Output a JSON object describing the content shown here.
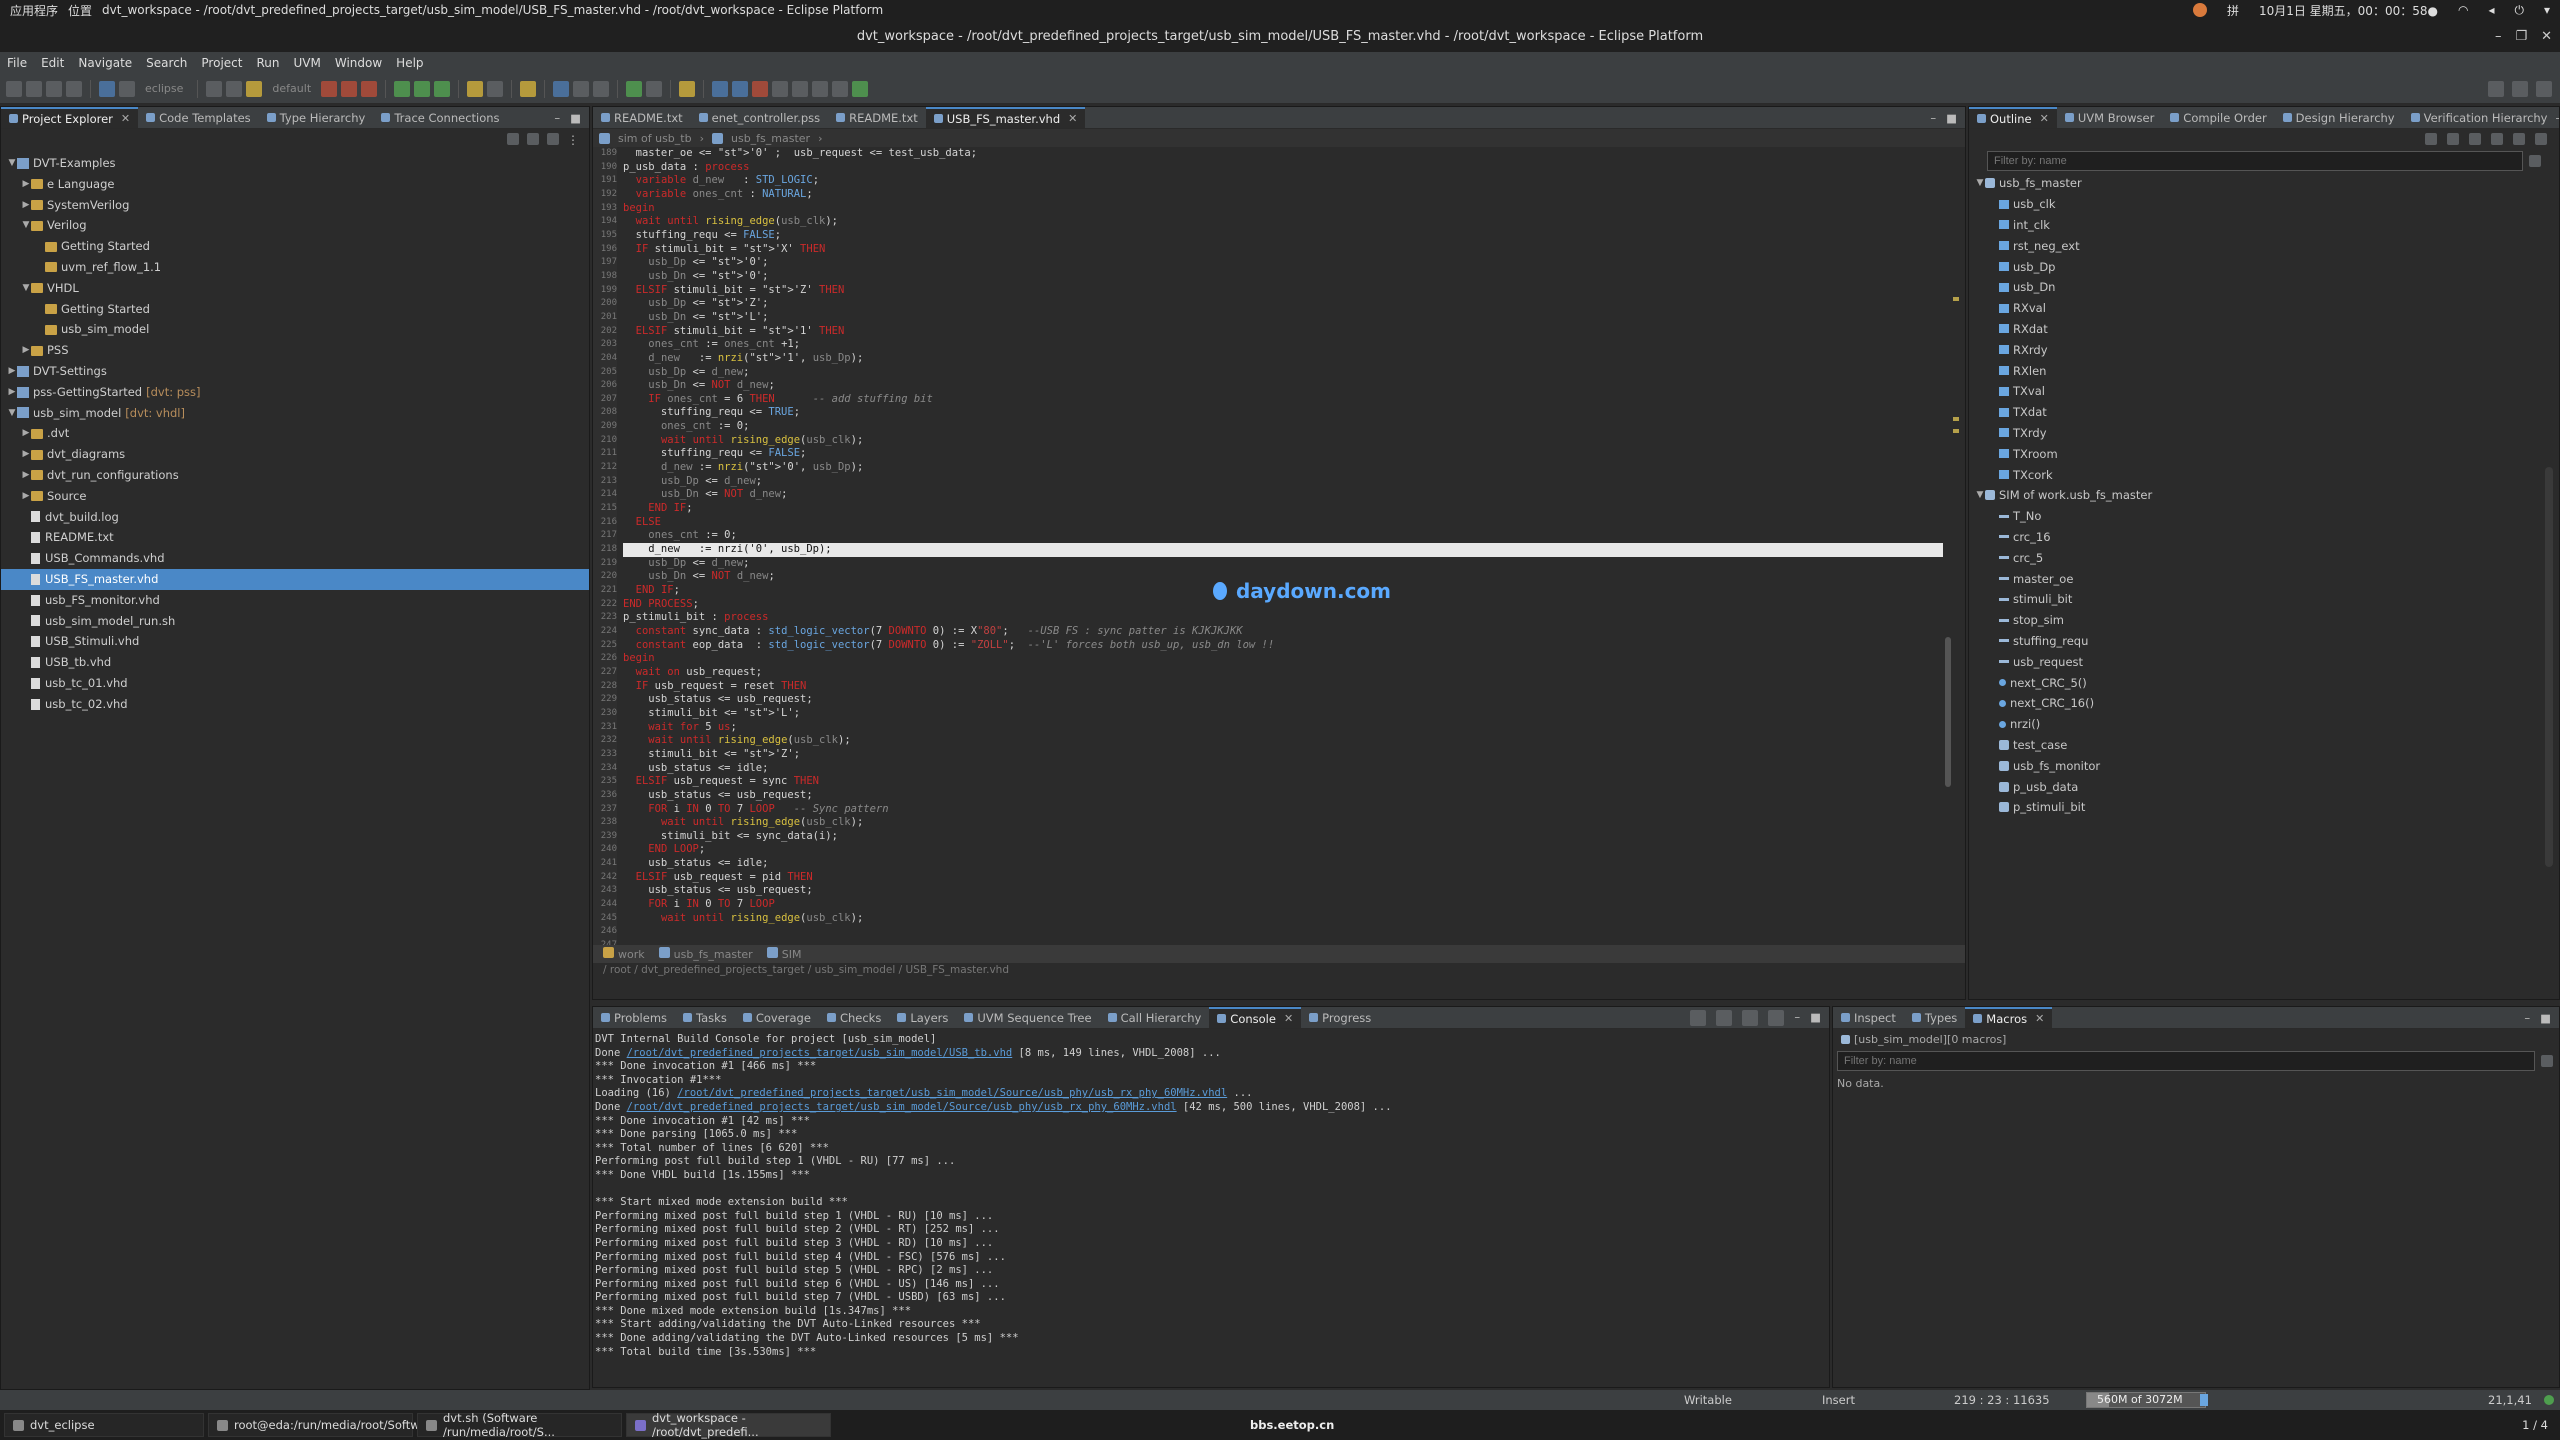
{
  "sys": {
    "apps": "应用程序",
    "places": "位置",
    "window": "dvt_workspace - /root/dvt_predefined_projects_target/usb_sim_model/USB_FS_master.vhd - /root/dvt_workspace - Eclipse Platform",
    "ime": "拼",
    "clock": "10月1日 星期五，00：00：58●"
  },
  "title": "dvt_workspace - /root/dvt_predefined_projects_target/usb_sim_model/USB_FS_master.vhd - /root/dvt_workspace - Eclipse Platform",
  "menu": [
    "File",
    "Edit",
    "Navigate",
    "Search",
    "Project",
    "Run",
    "UVM",
    "Window",
    "Help"
  ],
  "toolbar": {
    "eclipse_label": "eclipse",
    "default_label": "default"
  },
  "left_tabs": [
    {
      "label": "Project Explorer",
      "active": true
    },
    {
      "label": "Code Templates"
    },
    {
      "label": "Type Hierarchy"
    },
    {
      "label": "Trace Connections"
    }
  ],
  "tree": [
    {
      "d": 0,
      "t": "v",
      "k": "proj",
      "l": "DVT-Examples"
    },
    {
      "d": 1,
      "t": ">",
      "k": "fold",
      "l": "e Language"
    },
    {
      "d": 1,
      "t": ">",
      "k": "fold",
      "l": "SystemVerilog"
    },
    {
      "d": 1,
      "t": "v",
      "k": "fold",
      "l": "Verilog"
    },
    {
      "d": 2,
      "t": "",
      "k": "fold",
      "l": "Getting Started"
    },
    {
      "d": 2,
      "t": "",
      "k": "fold",
      "l": "uvm_ref_flow_1.1"
    },
    {
      "d": 1,
      "t": "v",
      "k": "fold",
      "l": "VHDL"
    },
    {
      "d": 2,
      "t": "",
      "k": "fold",
      "l": "Getting Started"
    },
    {
      "d": 2,
      "t": "",
      "k": "fold",
      "l": "usb_sim_model"
    },
    {
      "d": 1,
      "t": ">",
      "k": "fold",
      "l": "PSS"
    },
    {
      "d": 0,
      "t": ">",
      "k": "proj",
      "l": "DVT-Settings"
    },
    {
      "d": 0,
      "t": ">",
      "k": "proj",
      "l": "pss-GettingStarted",
      "x": "[dvt: pss]"
    },
    {
      "d": 0,
      "t": "v",
      "k": "proj",
      "l": "usb_sim_model",
      "x": "[dvt: vhdl]"
    },
    {
      "d": 1,
      "t": ">",
      "k": "fold",
      "l": ".dvt"
    },
    {
      "d": 1,
      "t": ">",
      "k": "fold",
      "l": "dvt_diagrams"
    },
    {
      "d": 1,
      "t": ">",
      "k": "fold",
      "l": "dvt_run_configurations"
    },
    {
      "d": 1,
      "t": ">",
      "k": "fold",
      "l": "Source"
    },
    {
      "d": 1,
      "t": "",
      "k": "file",
      "l": "dvt_build.log"
    },
    {
      "d": 1,
      "t": "",
      "k": "file",
      "l": "README.txt"
    },
    {
      "d": 1,
      "t": "",
      "k": "file",
      "l": "USB_Commands.vhd"
    },
    {
      "d": 1,
      "t": "",
      "k": "file",
      "l": "USB_FS_master.vhd",
      "sel": true
    },
    {
      "d": 1,
      "t": "",
      "k": "file",
      "l": "usb_FS_monitor.vhd"
    },
    {
      "d": 1,
      "t": "",
      "k": "file",
      "l": "usb_sim_model_run.sh"
    },
    {
      "d": 1,
      "t": "",
      "k": "file",
      "l": "USB_Stimuli.vhd"
    },
    {
      "d": 1,
      "t": "",
      "k": "file",
      "l": "USB_tb.vhd"
    },
    {
      "d": 1,
      "t": "",
      "k": "file",
      "l": "usb_tc_01.vhd"
    },
    {
      "d": 1,
      "t": "",
      "k": "file",
      "l": "usb_tc_02.vhd"
    }
  ],
  "editor_tabs": [
    {
      "label": "README.txt"
    },
    {
      "label": "enet_controller.pss"
    },
    {
      "label": "README.txt"
    },
    {
      "label": "USB_FS_master.vhd",
      "active": true
    }
  ],
  "editor_breadcrumb": [
    "sim of usb_tb",
    "usb_fs_master"
  ],
  "code_first_line": 189,
  "code": [
    "  master_oe <= '0' ;  usb_request <= test_usb_data;",
    "",
    "p_usb_data : process",
    "  variable d_new   : STD_LOGIC;",
    "  variable ones_cnt : NATURAL;",
    "begin",
    "  wait until rising_edge(usb_clk);",
    "  stuffing_requ <= FALSE;",
    "  IF stimuli_bit = 'X' THEN",
    "    usb_Dp <= '0';",
    "    usb_Dn <= '0';",
    "  ELSIF stimuli_bit = 'Z' THEN",
    "    usb_Dp <= 'Z';",
    "    usb_Dn <= 'L';",
    "  ELSIF stimuli_bit = '1' THEN",
    "    ones_cnt := ones_cnt +1;",
    "    d_new   := nrzi('1', usb_Dp);",
    "    usb_Dp <= d_new;",
    "    usb_Dn <= NOT d_new;",
    "    IF ones_cnt = 6 THEN      -- add stuffing bit",
    "      stuffing_requ <= TRUE;",
    "      ones_cnt := 0;",
    "      wait until rising_edge(usb_clk);",
    "      stuffing_requ <= FALSE;",
    "      d_new := nrzi('0', usb_Dp);",
    "      usb_Dp <= d_new;",
    "      usb_Dn <= NOT d_new;",
    "    END IF;",
    "  ELSE",
    "    ones_cnt := 0;",
    "    d_new   := nrzi('0', usb_Dp);",
    "    usb_Dp <= d_new;",
    "    usb_Dn <= NOT d_new;",
    "  END IF;",
    "END PROCESS;",
    "",
    "p_stimuli_bit : process",
    "  constant sync_data : std_logic_vector(7 DOWNTO 0) := X\"80\";   --USB FS : sync patter is KJKJKJKK",
    "  constant eop_data  : std_logic_vector(7 DOWNTO 0) := \"ZOLL\";  --'L' forces both usb_up, usb_dn low !!",
    "begin",
    "  wait on usb_request;",
    "  IF usb_request = reset THEN",
    "    usb_status <= usb_request;",
    "    stimuli_bit <= 'L';",
    "    wait for 5 us;",
    "    wait until rising_edge(usb_clk);",
    "    stimuli_bit <= 'Z';",
    "    usb_status <= idle;",
    "  ELSIF usb_request = sync THEN",
    "    usb_status <= usb_request;",
    "    FOR i IN 0 TO 7 LOOP   -- Sync pattern",
    "      wait until rising_edge(usb_clk);",
    "      stimuli_bit <= sync_data(i);",
    "    END LOOP;",
    "    usb_status <= idle;",
    "  ELSIF usb_request = pid THEN",
    "    usb_status <= usb_request;",
    "    FOR i IN 0 TO 7 LOOP",
    "      wait until rising_edge(usb_clk);"
  ],
  "editor_bottom_tabs": [
    "work",
    "usb_fs_master",
    "SIM"
  ],
  "editor_path": "/ root / dvt_predefined_projects_target / usb_sim_model / USB_FS_master.vhd",
  "watermark": "daydown.com",
  "right_tabs": [
    {
      "label": "Outline",
      "active": true
    },
    {
      "label": "UVM Browser"
    },
    {
      "label": "Compile Order"
    },
    {
      "label": "Design Hierarchy"
    },
    {
      "label": "Verification Hierarchy"
    }
  ],
  "outline_filter": "Filter by: name",
  "outline": [
    {
      "d": 0,
      "t": "v",
      "k": "ent",
      "l": "usb_fs_master"
    },
    {
      "d": 1,
      "k": "sig",
      "l": "usb_clk"
    },
    {
      "d": 1,
      "k": "sig",
      "l": "int_clk"
    },
    {
      "d": 1,
      "k": "sig",
      "l": "rst_neg_ext"
    },
    {
      "d": 1,
      "k": "sig",
      "l": "usb_Dp"
    },
    {
      "d": 1,
      "k": "sig",
      "l": "usb_Dn"
    },
    {
      "d": 1,
      "k": "sig",
      "l": "RXval"
    },
    {
      "d": 1,
      "k": "sig",
      "l": "RXdat"
    },
    {
      "d": 1,
      "k": "sig",
      "l": "RXrdy"
    },
    {
      "d": 1,
      "k": "sig",
      "l": "RXlen"
    },
    {
      "d": 1,
      "k": "sig",
      "l": "TXval"
    },
    {
      "d": 1,
      "k": "sig",
      "l": "TXdat"
    },
    {
      "d": 1,
      "k": "sig",
      "l": "TXrdy"
    },
    {
      "d": 1,
      "k": "sig",
      "l": "TXroom"
    },
    {
      "d": 1,
      "k": "sig",
      "l": "TXcork"
    },
    {
      "d": 0,
      "t": "v",
      "k": "ent",
      "l": "SIM of work.usb_fs_master"
    },
    {
      "d": 1,
      "k": "var",
      "l": "T_No"
    },
    {
      "d": 1,
      "k": "var",
      "l": "crc_16"
    },
    {
      "d": 1,
      "k": "var",
      "l": "crc_5"
    },
    {
      "d": 1,
      "k": "var",
      "l": "master_oe"
    },
    {
      "d": 1,
      "k": "var",
      "l": "stimuli_bit"
    },
    {
      "d": 1,
      "k": "var",
      "l": "stop_sim"
    },
    {
      "d": 1,
      "k": "var",
      "l": "stuffing_requ"
    },
    {
      "d": 1,
      "k": "var",
      "l": "usb_request"
    },
    {
      "d": 1,
      "k": "prc",
      "l": "next_CRC_5()"
    },
    {
      "d": 1,
      "k": "prc",
      "l": "next_CRC_16()"
    },
    {
      "d": 1,
      "k": "prc",
      "l": "nrzi()"
    },
    {
      "d": 1,
      "k": "ent",
      "l": "test_case"
    },
    {
      "d": 1,
      "k": "ent",
      "l": "usb_fs_monitor"
    },
    {
      "d": 1,
      "k": "ent",
      "l": "p_usb_data"
    },
    {
      "d": 1,
      "k": "ent",
      "l": "p_stimuli_bit"
    }
  ],
  "bottom_tabs": [
    {
      "label": "Problems"
    },
    {
      "label": "Tasks"
    },
    {
      "label": "Coverage"
    },
    {
      "label": "Checks"
    },
    {
      "label": "Layers"
    },
    {
      "label": "UVM Sequence Tree"
    },
    {
      "label": "Call Hierarchy"
    },
    {
      "label": "Console",
      "active": true
    },
    {
      "label": "Progress"
    }
  ],
  "console": [
    {
      "t": "DVT Internal Build Console for project [usb_sim_model]"
    },
    {
      "pre": "Done ",
      "link": "/root/dvt_predefined_projects_target/usb_sim_model/USB_tb.vhd",
      "post": " [8 ms, 149 lines, VHDL_2008] ..."
    },
    {
      "t": "*** Done invocation #1 [466 ms] ***"
    },
    {
      "t": "*** Invocation #1***"
    },
    {
      "pre": "Loading (16) ",
      "link": "/root/dvt_predefined_projects_target/usb_sim_model/Source/usb_phy/usb_rx_phy_60MHz.vhdl",
      "post": " ..."
    },
    {
      "pre": "Done ",
      "link": "/root/dvt_predefined_projects_target/usb_sim_model/Source/usb_phy/usb_rx_phy_60MHz.vhdl",
      "post": " [42 ms, 500 lines, VHDL_2008] ..."
    },
    {
      "t": "*** Done invocation #1 [42 ms] ***"
    },
    {
      "t": "*** Done parsing [1065.0 ms] ***"
    },
    {
      "t": "*** Total number of lines [6 620] ***"
    },
    {
      "t": "Performing post full build step 1 (VHDL - RU) [77 ms] ..."
    },
    {
      "t": "*** Done VHDL build [1s.155ms] ***"
    },
    {
      "t": ""
    },
    {
      "t": "*** Start mixed mode extension build ***"
    },
    {
      "t": "Performing mixed post full build step 1 (VHDL - RU) [10 ms] ..."
    },
    {
      "t": "Performing mixed post full build step 2 (VHDL - RT) [252 ms] ..."
    },
    {
      "t": "Performing mixed post full build step 3 (VHDL - RD) [10 ms] ..."
    },
    {
      "t": "Performing mixed post full build step 4 (VHDL - FSC) [576 ms] ..."
    },
    {
      "t": "Performing mixed post full build step 5 (VHDL - RPC) [2 ms] ..."
    },
    {
      "t": "Performing mixed post full build step 6 (VHDL - US) [146 ms] ..."
    },
    {
      "t": "Performing mixed post full build step 7 (VHDL - USBD) [63 ms] ..."
    },
    {
      "t": "*** Done mixed mode extension build [1s.347ms] ***"
    },
    {
      "t": "*** Start adding/validating the DVT Auto-Linked resources ***"
    },
    {
      "t": "*** Done adding/validating the DVT Auto-Linked resources [5 ms] ***"
    },
    {
      "t": "*** Total build time [3s.530ms] ***"
    }
  ],
  "macro_tabs": [
    {
      "label": "Inspect"
    },
    {
      "label": "Types"
    },
    {
      "label": "Macros",
      "active": true
    }
  ],
  "macros": {
    "header": "[usb_sim_model][0 macros]",
    "filter": "Filter by: name",
    "nodata": "No data."
  },
  "status": {
    "writable": "Writable",
    "insert": "Insert",
    "pos": "219 : 23 : 11635",
    "mem": "560M of 3072M",
    "right": "21,1,41"
  },
  "taskbar": {
    "items": [
      {
        "label": "dvt_eclipse"
      },
      {
        "label": "root@eda:/run/media/root/Softwar..."
      },
      {
        "label": "dvt.sh (Software /run/media/root/S..."
      },
      {
        "label": "dvt_workspace - /root/dvt_predefi...",
        "active": true
      }
    ],
    "center": "bbs.eetop.cn",
    "pager": "1 / 4"
  }
}
